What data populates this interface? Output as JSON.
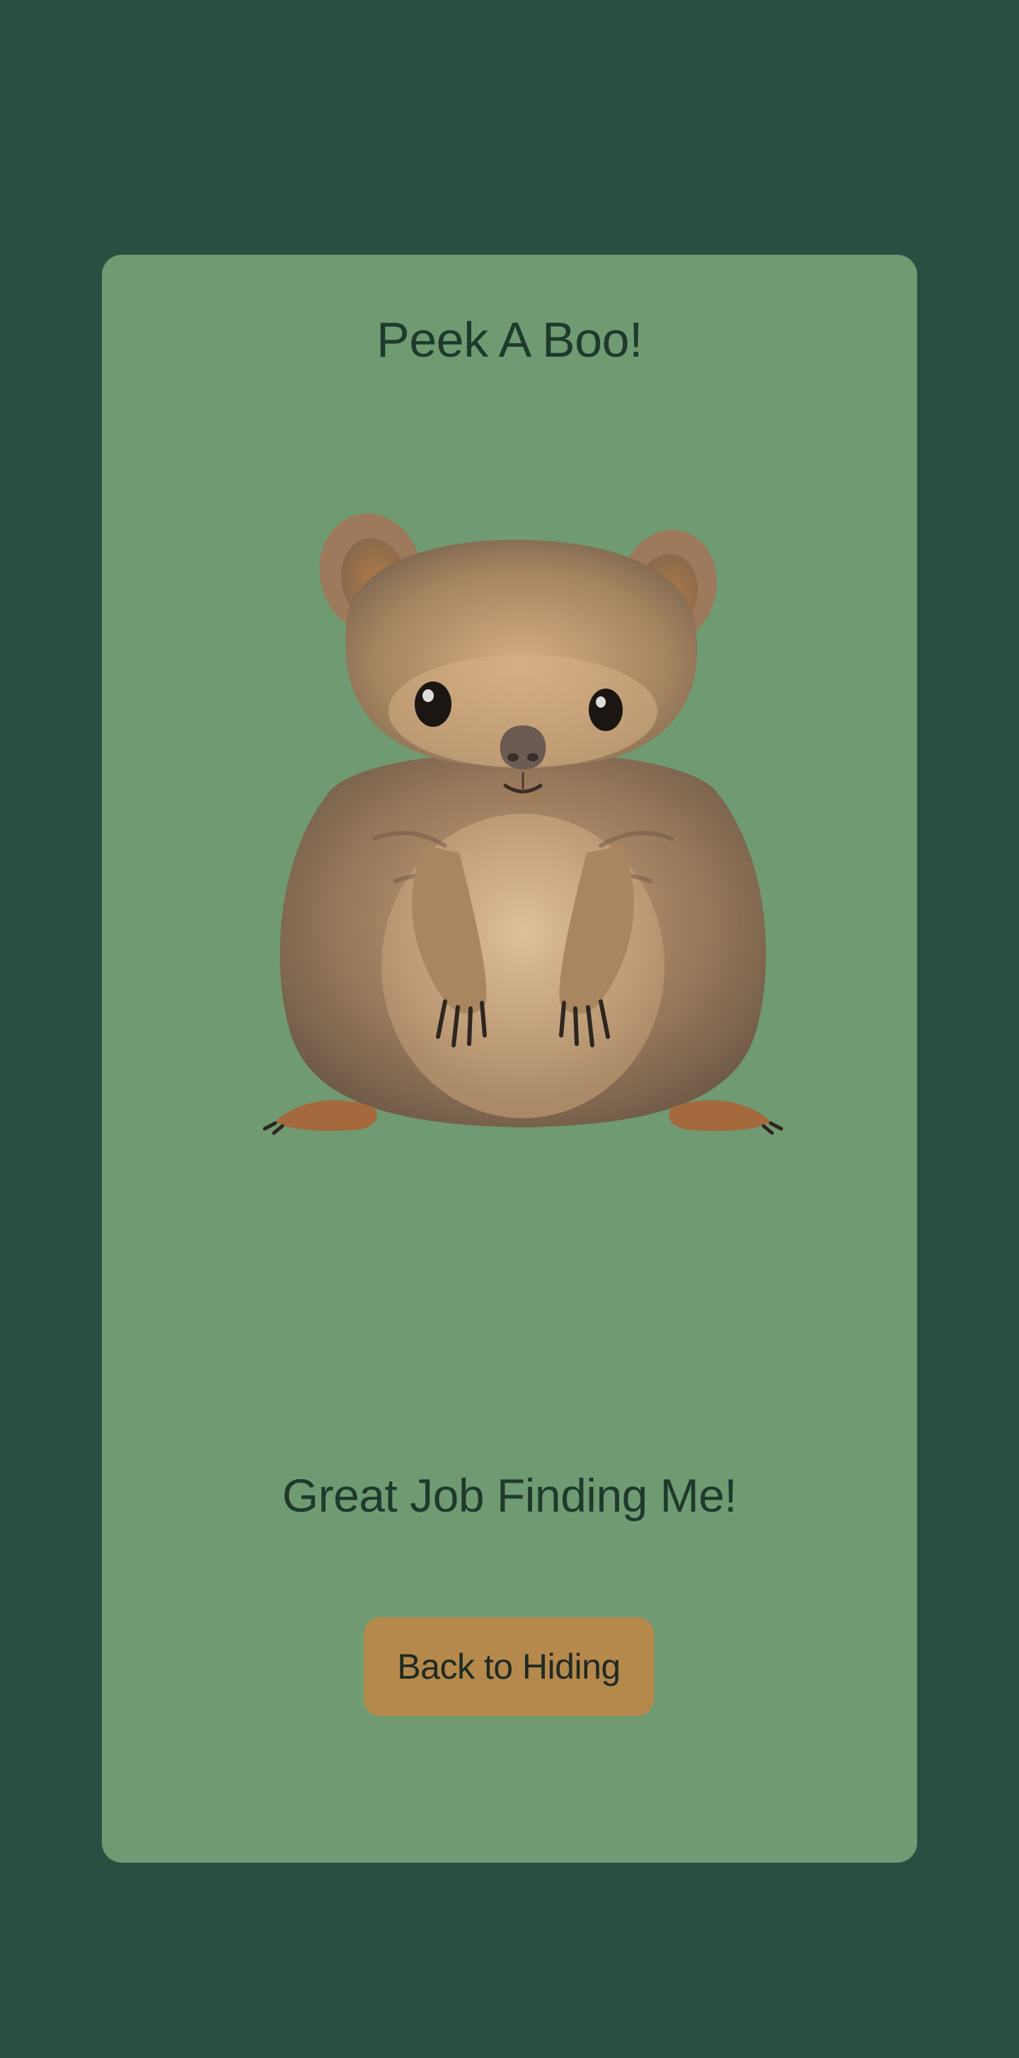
{
  "page": {
    "background_color": "#2a4f42",
    "card_color": "#709a72",
    "text_color": "#1d3a2c",
    "button_color": "#b5884b"
  },
  "card": {
    "title": "Peek A Boo!",
    "image_icon": "quokka-illustration",
    "message": "Great Job Finding Me!",
    "button_label": "Back to Hiding"
  }
}
